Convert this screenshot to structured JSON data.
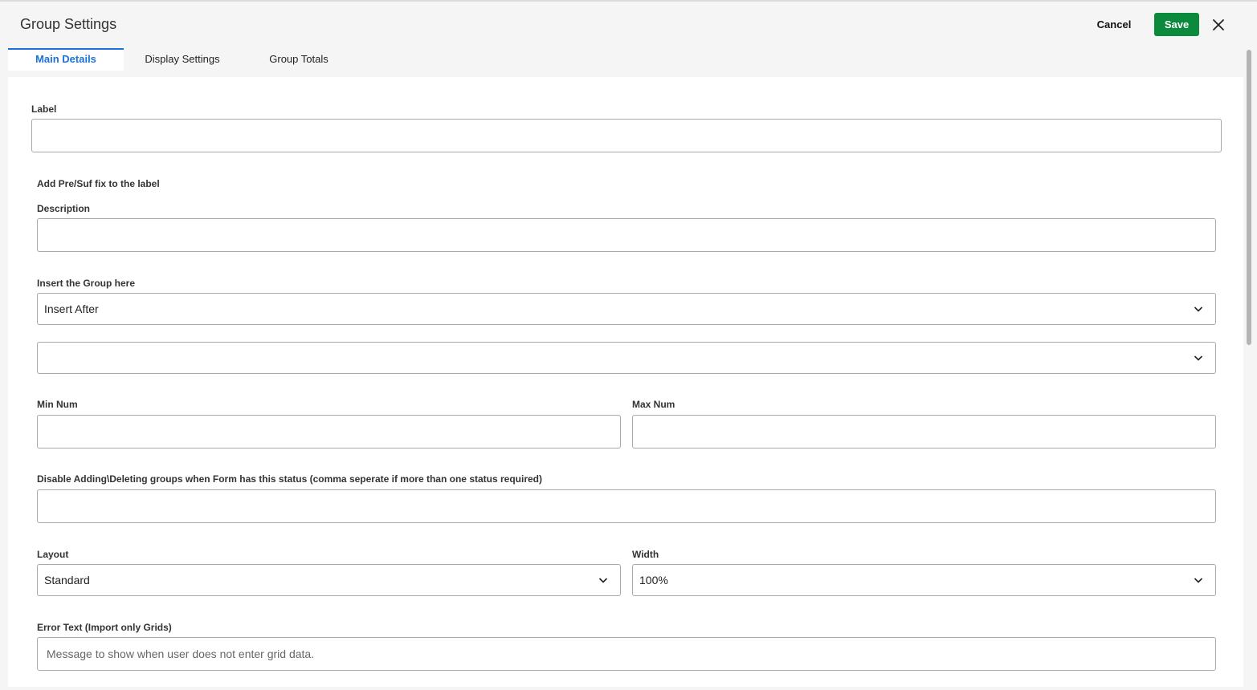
{
  "header": {
    "title": "Group Settings",
    "cancel_label": "Cancel",
    "save_label": "Save"
  },
  "tabs": [
    {
      "label": "Main Details",
      "active": true
    },
    {
      "label": "Display Settings",
      "active": false
    },
    {
      "label": "Group Totals",
      "active": false
    }
  ],
  "form": {
    "label_label": "Label",
    "label_value": "",
    "prefix_suffix_label": "Add Pre/Suf fix to the label",
    "description_label": "Description",
    "description_value": "",
    "insert_label": "Insert the Group here",
    "insert_value": "Insert After",
    "insert_target_value": "",
    "min_num_label": "Min Num",
    "min_num_value": "",
    "max_num_label": "Max Num",
    "max_num_value": "",
    "disable_status_label": "Disable Adding\\Deleting groups when Form has this status (comma seperate if more than one status required)",
    "disable_status_value": "",
    "layout_label": "Layout",
    "layout_value": "Standard",
    "width_label": "Width",
    "width_value": "100%",
    "error_text_label": "Error Text (Import only Grids)",
    "error_text_placeholder": "Message to show when user does not enter grid data."
  },
  "colors": {
    "accent": "#1a73d9",
    "save_button": "#0b8a3e",
    "background": "#f5f5f5"
  }
}
